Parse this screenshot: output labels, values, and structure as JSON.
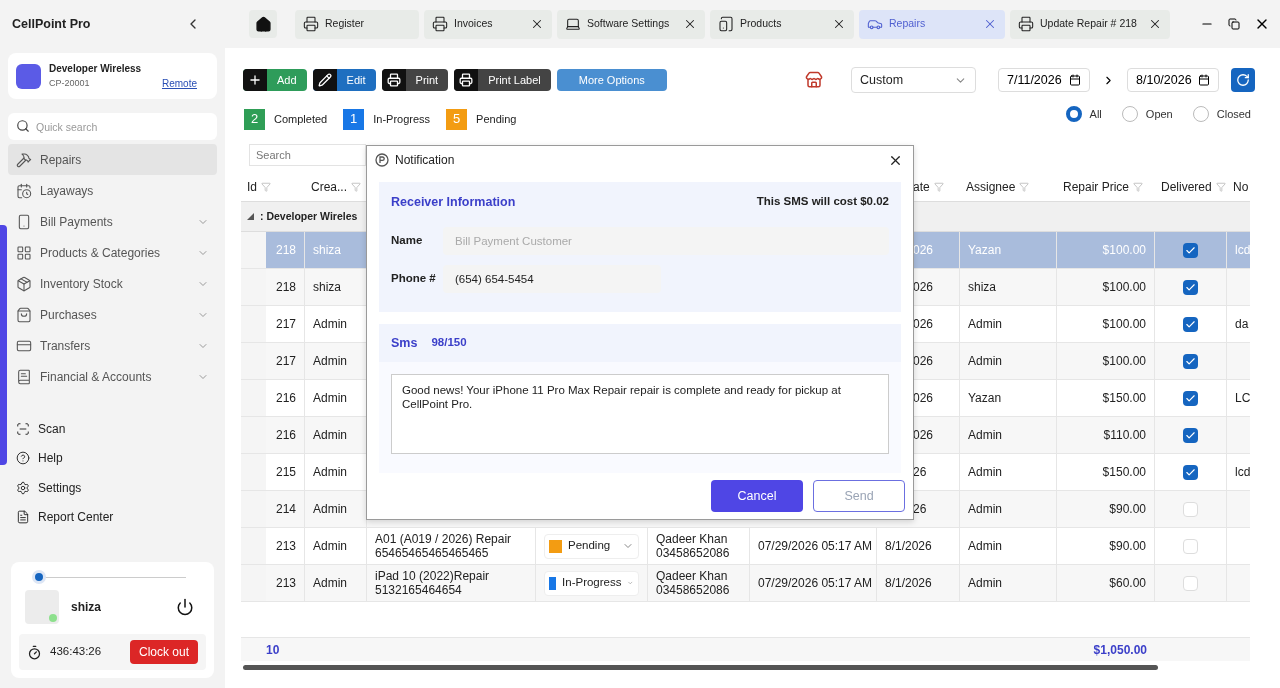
{
  "app": {
    "title": "CellPoint Pro"
  },
  "account": {
    "name": "Developer Wireless",
    "code": "CP-20001",
    "link": "Remote"
  },
  "quick_search": {
    "placeholder": "Quick search"
  },
  "nav": [
    {
      "label": "Repairs",
      "selected": true,
      "expandable": false
    },
    {
      "label": "Layaways",
      "selected": false,
      "expandable": false
    },
    {
      "label": "Bill Payments",
      "selected": false,
      "expandable": true
    },
    {
      "label": "Products & Categories",
      "selected": false,
      "expandable": true
    },
    {
      "label": "Inventory Stock",
      "selected": false,
      "expandable": true
    },
    {
      "label": "Purchases",
      "selected": false,
      "expandable": true
    },
    {
      "label": "Transfers",
      "selected": false,
      "expandable": true
    },
    {
      "label": "Financial & Accounts",
      "selected": false,
      "expandable": true
    }
  ],
  "tools": [
    {
      "label": "Scan"
    },
    {
      "label": "Help"
    },
    {
      "label": "Settings"
    },
    {
      "label": "Report Center"
    }
  ],
  "user": {
    "name": "shiza",
    "online": true,
    "level": 0,
    "timer": "436:43:26",
    "clock_button": "Clock out"
  },
  "tabs": [
    {
      "label": "Register",
      "selected": false,
      "closable": false
    },
    {
      "label": "Invoices",
      "selected": false,
      "closable": true
    },
    {
      "label": "Software Settings",
      "selected": false,
      "closable": true
    },
    {
      "label": "Products",
      "selected": false,
      "closable": true
    },
    {
      "label": "Repairs",
      "selected": true,
      "closable": true
    },
    {
      "label": "Update Repair # 218",
      "selected": false,
      "closable": true
    }
  ],
  "toolbar": {
    "buttons": [
      {
        "label": "Add",
        "color": "#2e9c5a"
      },
      {
        "label": "Edit",
        "color": "#1f6fc0"
      },
      {
        "label": "Print",
        "color": "#444444"
      },
      {
        "label": "Print Label",
        "color": "#444444"
      }
    ],
    "more": "More Options"
  },
  "filter": {
    "range": "Custom",
    "from": "7/11/2026",
    "to": "8/10/2026"
  },
  "stats": [
    {
      "count": "2",
      "label": "Completed",
      "color": "#2f9e56"
    },
    {
      "count": "1",
      "label": "In-Progress",
      "color": "#1877e6"
    },
    {
      "count": "5",
      "label": "Pending",
      "color": "#f39c12"
    }
  ],
  "radios": [
    {
      "label": "All",
      "selected": true
    },
    {
      "label": "Open",
      "selected": false
    },
    {
      "label": "Closed",
      "selected": false
    }
  ],
  "search": {
    "placeholder": "Search"
  },
  "table": {
    "columns": [
      {
        "label": "Id",
        "filterable": true
      },
      {
        "label": "Crea...",
        "filterable": true
      },
      {
        "label": "ate",
        "filterable": true
      },
      {
        "label": "Assignee",
        "filterable": true
      },
      {
        "label": "Repair Price",
        "filterable": true
      },
      {
        "label": "Delivered",
        "filterable": true
      },
      {
        "label": "No"
      }
    ],
    "group": ": Developer Wireles",
    "rows": [
      {
        "kind": "covered",
        "selected": true,
        "id": "218",
        "creator": "shiza",
        "date": "026",
        "assignee": "Yazan",
        "price": "$100.00",
        "delivered": true,
        "note": "lcd"
      },
      {
        "kind": "covered",
        "selected": false,
        "id": "218",
        "creator": "shiza",
        "date": "026",
        "assignee": "shiza",
        "price": "$100.00",
        "delivered": true
      },
      {
        "kind": "covered",
        "selected": false,
        "id": "217",
        "creator": "Admin",
        "date": "026",
        "assignee": "Admin",
        "price": "$100.00",
        "delivered": true,
        "note": "da"
      },
      {
        "kind": "covered",
        "selected": false,
        "id": "217",
        "creator": "Admin",
        "date": "026",
        "assignee": "Admin",
        "price": "$100.00",
        "delivered": true
      },
      {
        "kind": "covered",
        "selected": false,
        "id": "216",
        "creator": "Admin",
        "date": "026",
        "assignee": "Yazan",
        "price": "$150.00",
        "delivered": true,
        "note": "LC"
      },
      {
        "kind": "covered",
        "selected": false,
        "id": "216",
        "creator": "Admin",
        "date": "026",
        "assignee": "Admin",
        "price": "$110.00",
        "delivered": true
      },
      {
        "kind": "covered",
        "selected": false,
        "id": "215",
        "creator": "Admin",
        "date": "26",
        "assignee": "Admin",
        "price": "$150.00",
        "delivered": true,
        "note": "lcd"
      },
      {
        "kind": "covered",
        "selected": false,
        "id": "214",
        "creator": "Admin",
        "date": "26",
        "assignee": "Admin",
        "price": "$90.00",
        "delivered": false
      },
      {
        "kind": "full",
        "selected": false,
        "id": "213",
        "creator": "Admin",
        "description": "A01 (A019 / 2026) Repair 65465465465465465",
        "status": {
          "label": "Pending",
          "color": "#f39c12"
        },
        "customer": "Qadeer Khan 03458652086",
        "created": "07/29/2026 05:17 AM",
        "date": "8/1/2026",
        "assignee": "Admin",
        "price": "$90.00",
        "delivered": false
      },
      {
        "kind": "full",
        "selected": false,
        "id": "213",
        "creator": "Admin",
        "description": "iPad 10 (2022)Repair 5132165464654",
        "status": {
          "label": "In-Progress",
          "color": "#1877e6"
        },
        "customer": "Qadeer Khan 03458652086",
        "created": "07/29/2026 05:17 AM",
        "date": "8/1/2026",
        "assignee": "Admin",
        "price": "$60.00",
        "delivered": false
      }
    ],
    "footer": {
      "count": "10",
      "total": "$1,050.00"
    }
  },
  "dialog": {
    "title": "Notification",
    "receiver_heading": "Receiver Information",
    "cost": "This SMS will cost $0.02",
    "fields": [
      {
        "label": "Name",
        "placeholder": "Bill Payment Customer"
      },
      {
        "label": "Phone #",
        "value": "(654) 654-5454"
      }
    ],
    "sms_heading": "Sms",
    "sms_count": "98/150",
    "message": "Good news! Your iPhone 11 Pro Max Repair repair is complete and ready for pickup at CellPoint Pro.",
    "buttons": [
      {
        "label": "Cancel",
        "kind": "primary",
        "disabled": false
      },
      {
        "label": "Send",
        "kind": "outline",
        "disabled": true
      }
    ]
  }
}
